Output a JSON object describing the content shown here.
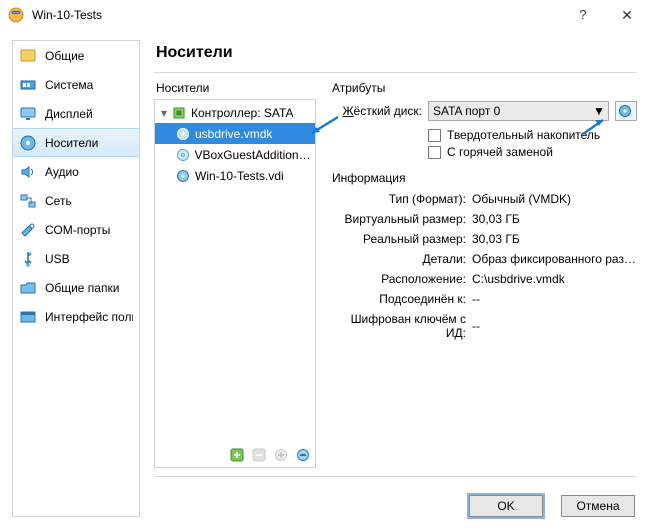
{
  "window": {
    "title": "Win-10-Tests"
  },
  "sidebar": {
    "items": [
      {
        "label": "Общие"
      },
      {
        "label": "Система"
      },
      {
        "label": "Дисплей"
      },
      {
        "label": "Носители"
      },
      {
        "label": "Аудио"
      },
      {
        "label": "Сеть"
      },
      {
        "label": "СОМ-порты"
      },
      {
        "label": "USB"
      },
      {
        "label": "Общие папки"
      },
      {
        "label": "Интерфейс пользователя"
      }
    ],
    "active_index": 3
  },
  "page": {
    "title": "Носители",
    "storage_label": "Носители",
    "attributes_label": "Атрибуты",
    "information_label": "Информация"
  },
  "tree": {
    "controller_label": "Контроллер: SATA",
    "items": [
      {
        "label": "usbdrive.vmdk"
      },
      {
        "label": "VBoxGuestAdditions..."
      },
      {
        "label": "Win-10-Tests.vdi"
      }
    ],
    "selected_index": 0
  },
  "attributes": {
    "hdd_label_pre": "Ж",
    "hdd_label_post": "ёсткий диск:",
    "port_value": "SATA порт 0",
    "ssd_label_pre": "Т",
    "ssd_label_post": "вердотельный накопитель",
    "hot_label_pre": "С",
    "hot_label_post": " горячей заменой"
  },
  "info": {
    "rows": [
      {
        "k": "Тип (Формат):",
        "v": "Обычный (VMDK)"
      },
      {
        "k": "Виртуальный размер:",
        "v": "30,03 ГБ"
      },
      {
        "k": "Реальный размер:",
        "v": "30,03 ГБ"
      },
      {
        "k": "Детали:",
        "v": "Образ фиксированного разме..."
      },
      {
        "k": "Расположение:",
        "v": "C:\\usbdrive.vmdk"
      },
      {
        "k": "Подсоединён к:",
        "v": "--"
      },
      {
        "k": "Шифрован ключём с ИД:",
        "v": "--"
      }
    ]
  },
  "buttons": {
    "ok": "OK",
    "cancel": "Отмена"
  }
}
